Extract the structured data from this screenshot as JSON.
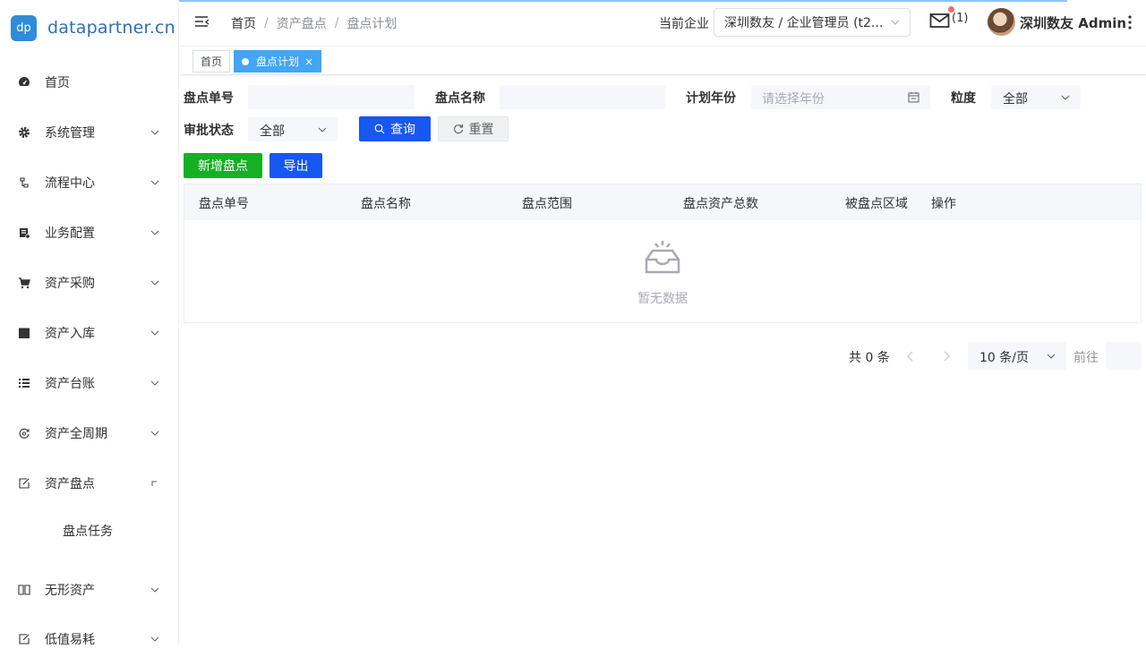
{
  "brand": {
    "logo_text": "dp",
    "name": "datapartner.cn"
  },
  "sidebar": {
    "items": [
      {
        "label": "首页",
        "icon": "dashboard-icon"
      },
      {
        "label": "系统管理",
        "icon": "gear-icon"
      },
      {
        "label": "流程中心",
        "icon": "flow-icon"
      },
      {
        "label": "业务配置",
        "icon": "business-config-icon"
      },
      {
        "label": "资产采购",
        "icon": "cart-icon"
      },
      {
        "label": "资产入库",
        "icon": "clapper-icon"
      },
      {
        "label": "资产台账",
        "icon": "list-icon"
      },
      {
        "label": "资产全周期",
        "icon": "cycle-icon"
      },
      {
        "label": "资产盘点",
        "icon": "edit-icon"
      },
      {
        "label": "无形资产",
        "icon": "book-icon"
      },
      {
        "label": "低值易耗",
        "icon": "edit-icon"
      }
    ],
    "sub_items": [
      {
        "label": "盘点任务"
      }
    ]
  },
  "header": {
    "breadcrumb": [
      "首页",
      "资产盘点",
      "盘点计划"
    ],
    "company_label": "当前企业",
    "company_value": "深圳数友 / 企业管理员 (t2...",
    "mail_count": "(1)",
    "user_name": "深圳数友 Admin"
  },
  "tabs": [
    {
      "label": "首页",
      "active": false
    },
    {
      "label": "盘点计划",
      "active": true,
      "close": "×"
    }
  ],
  "search": {
    "order_no_label": "盘点单号",
    "name_label": "盘点名称",
    "year_label": "计划年份",
    "year_placeholder": "请选择年份",
    "granularity_label": "粒度",
    "granularity_value": "全部",
    "approval_label": "审批状态",
    "approval_value": "全部",
    "query_label": "查询",
    "reset_label": "重置"
  },
  "actions": {
    "add_label": "新增盘点",
    "export_label": "导出"
  },
  "table": {
    "columns": [
      "盘点单号",
      "盘点名称",
      "盘点范围",
      "盘点资产总数",
      "被盘点区域",
      "操作"
    ],
    "empty_text": "暂无数据"
  },
  "pagination": {
    "total_text": "共 0 条",
    "page_size": "10 条/页",
    "goto_label": "前往"
  },
  "colors": {
    "primary": "#1757f2",
    "success": "#15b024",
    "tab_active": "#42a5f5"
  }
}
